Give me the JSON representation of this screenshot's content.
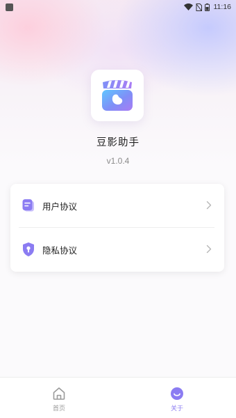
{
  "status_bar": {
    "time": "11:16"
  },
  "app": {
    "name": "豆影助手",
    "version": "v1.0.4"
  },
  "menu": {
    "items": [
      {
        "label": "用户协议",
        "icon": "document-icon"
      },
      {
        "label": "隐私协议",
        "icon": "shield-lock-icon"
      }
    ]
  },
  "tab_bar": {
    "tabs": [
      {
        "label": "首页",
        "icon": "home-icon",
        "active": false
      },
      {
        "label": "关于",
        "icon": "smile-icon",
        "active": true
      }
    ]
  },
  "colors": {
    "accent": "#8b7cf2",
    "text_primary": "#222222",
    "text_secondary": "#8a8a8a"
  }
}
